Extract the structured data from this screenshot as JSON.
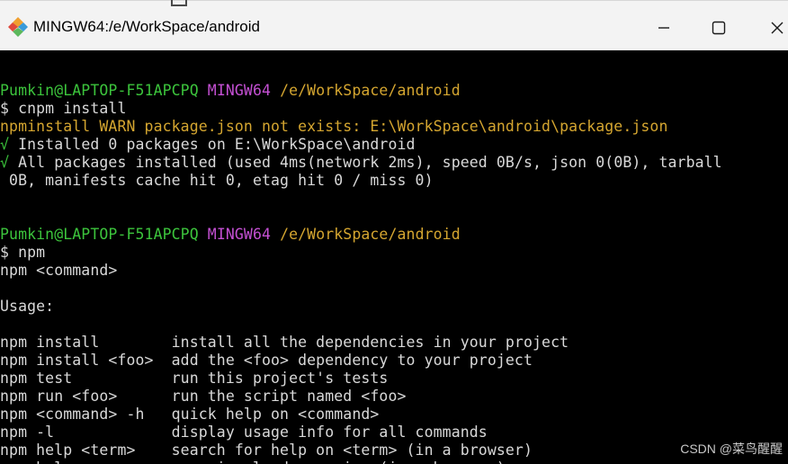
{
  "window": {
    "title": "MINGW64:/e/WorkSpace/android"
  },
  "colors": {
    "green": "#3cc43c",
    "purple": "#c450d3",
    "yellow": "#d5a630",
    "text": "#d9d9d9",
    "background": "#000000",
    "titlebar": "#f3f3f3"
  },
  "icons": {
    "app": "git-bash-diamond-icon",
    "minimize": "minimize-icon",
    "maximize": "maximize-icon",
    "close": "close-icon"
  },
  "terminal": {
    "lines": [
      {
        "segments": []
      },
      {
        "segments": [
          {
            "text": "Pumkin@LAPTOP-F51APCPQ ",
            "color": "green"
          },
          {
            "text": "MINGW64 ",
            "color": "purple"
          },
          {
            "text": "/e/WorkSpace/android",
            "color": "yellow"
          }
        ]
      },
      {
        "segments": [
          {
            "text": "$ cnpm install",
            "color": "text"
          }
        ]
      },
      {
        "segments": [
          {
            "text": "npminstall WARN package.json not exists: E:\\WorkSpace\\android\\package.json",
            "color": "yellow"
          }
        ]
      },
      {
        "segments": [
          {
            "text": "√",
            "color": "green"
          },
          {
            "text": " Installed 0 packages on E:\\WorkSpace\\android",
            "color": "text"
          }
        ]
      },
      {
        "segments": [
          {
            "text": "√",
            "color": "green"
          },
          {
            "text": " All packages installed (used 4ms(network 2ms), speed 0B/s, json 0(0B), tarball",
            "color": "text"
          }
        ]
      },
      {
        "segments": [
          {
            "text": " 0B, manifests cache hit 0, etag hit 0 / miss 0)",
            "color": "text"
          }
        ]
      },
      {
        "segments": []
      },
      {
        "segments": []
      },
      {
        "segments": [
          {
            "text": "Pumkin@LAPTOP-F51APCPQ ",
            "color": "green"
          },
          {
            "text": "MINGW64 ",
            "color": "purple"
          },
          {
            "text": "/e/WorkSpace/android",
            "color": "yellow"
          }
        ]
      },
      {
        "segments": [
          {
            "text": "$ npm",
            "color": "text"
          }
        ]
      },
      {
        "segments": [
          {
            "text": "npm <command>",
            "color": "text"
          }
        ]
      },
      {
        "segments": []
      },
      {
        "segments": [
          {
            "text": "Usage:",
            "color": "text"
          }
        ]
      },
      {
        "segments": []
      },
      {
        "segments": [
          {
            "text": "npm install        install all the dependencies in your project",
            "color": "text"
          }
        ]
      },
      {
        "segments": [
          {
            "text": "npm install <foo>  add the <foo> dependency to your project",
            "color": "text"
          }
        ]
      },
      {
        "segments": [
          {
            "text": "npm test           run this project's tests",
            "color": "text"
          }
        ]
      },
      {
        "segments": [
          {
            "text": "npm run <foo>      run the script named <foo>",
            "color": "text"
          }
        ]
      },
      {
        "segments": [
          {
            "text": "npm <command> -h   quick help on <command>",
            "color": "text"
          }
        ]
      },
      {
        "segments": [
          {
            "text": "npm -l             display usage info for all commands",
            "color": "text"
          }
        ]
      },
      {
        "segments": [
          {
            "text": "npm help <term>    search for help on <term> (in a browser)",
            "color": "text"
          }
        ]
      },
      {
        "segments": [
          {
            "text": "npm help npm       more involved overview (in a browser)",
            "color": "text"
          }
        ]
      }
    ]
  },
  "watermark": {
    "text": "CSDN @菜鸟醒醒"
  }
}
